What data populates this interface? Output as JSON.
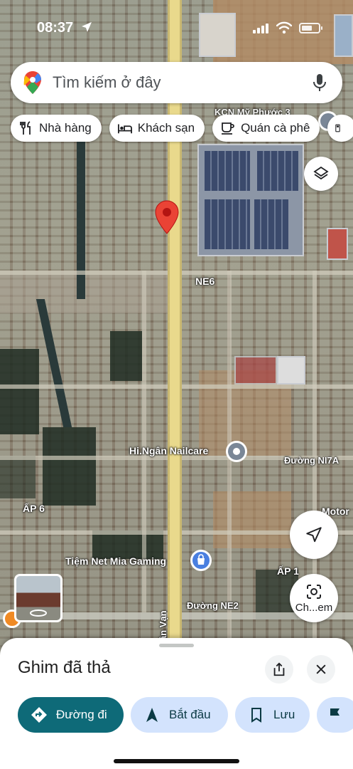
{
  "status_bar": {
    "time": "08:37"
  },
  "search": {
    "placeholder": "Tìm kiếm ở đây"
  },
  "chips": [
    {
      "label": "Nhà hàng",
      "icon": "restaurant-icon"
    },
    {
      "label": "Khách sạn",
      "icon": "hotel-icon"
    },
    {
      "label": "Quán cà phê",
      "icon": "coffee-icon"
    }
  ],
  "map": {
    "labels": {
      "kcn": "KCN Mỹ Phước 3",
      "ne6": "NE6",
      "nailcare": "Hi.Ngân Nailcare",
      "ni7a": "Đường NI7A",
      "motor": "Motor",
      "ap6": "ẤP 6",
      "gaming": "Tiệm Net Mia Gaming",
      "ap1": "ẤP 1",
      "ne2": "Đường NE2",
      "tan_van": "Tân Vạn"
    },
    "lens_label": "Ch...em"
  },
  "sheet": {
    "title": "Ghim đã thả",
    "actions": [
      {
        "label": "Đường đi",
        "icon": "directions-icon"
      },
      {
        "label": "Bắt đầu",
        "icon": "navigation-arrow-icon"
      },
      {
        "label": "Lưu",
        "icon": "bookmark-icon"
      }
    ]
  },
  "colors": {
    "primary_action": "#0e6a78",
    "secondary_action": "#d3e3fd",
    "pin_red": "#ea4335",
    "road": "#e9d98c"
  }
}
